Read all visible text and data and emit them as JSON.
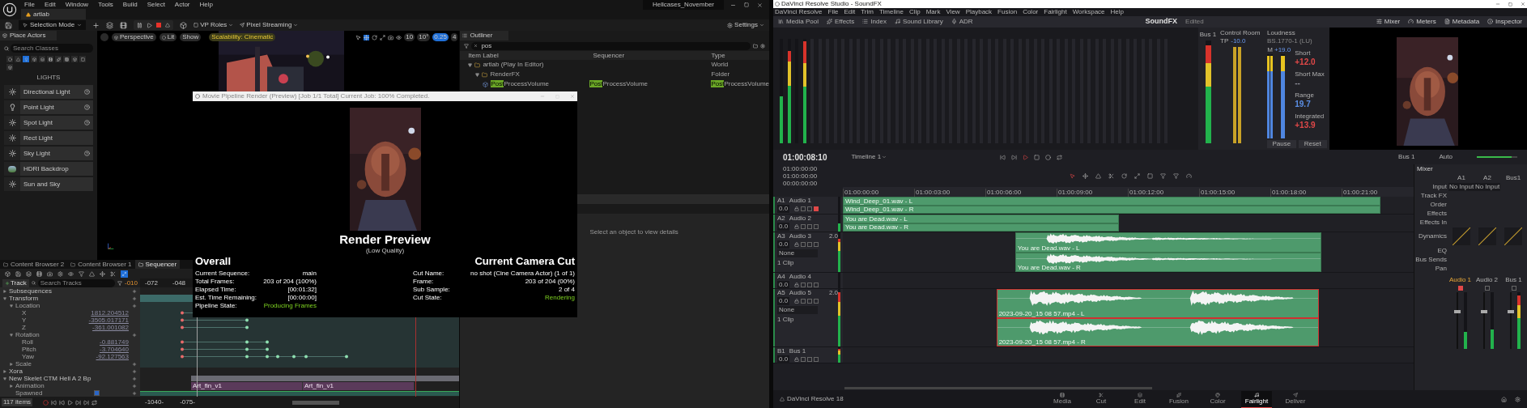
{
  "unreal": {
    "menu": [
      "File",
      "Edit",
      "Window",
      "Tools",
      "Build",
      "Select",
      "Actor",
      "Help"
    ],
    "document_tab": "artlab",
    "project": "Hellcases_November",
    "toolbar": {
      "mode": "Selection Mode",
      "vp_roles": "VP Roles",
      "pixel_streaming": "Pixel Streaming",
      "settings": "Settings"
    },
    "place_actors": {
      "title": "Place Actors",
      "search_placeholder": "Search Classes",
      "category": "LIGHTS",
      "category_tabs": [
        {
          "selected": false
        },
        {
          "selected": false
        },
        {
          "selected": true
        },
        {
          "selected": false
        },
        {
          "selected": false
        },
        {
          "selected": false
        },
        {
          "selected": false
        },
        {
          "selected": false
        },
        {
          "selected": false
        },
        {
          "selected": false
        },
        {
          "selected": false
        }
      ],
      "items": [
        {
          "label": "Directional Light",
          "help": true
        },
        {
          "label": "Point Light",
          "help": true
        },
        {
          "label": "Spot Light",
          "help": true
        },
        {
          "label": "Rect Light",
          "help": false
        },
        {
          "label": "Sky Light",
          "help": true
        },
        {
          "label": "HDRI Backdrop",
          "help": false
        },
        {
          "label": "Sun and Sky",
          "help": false
        }
      ]
    },
    "viewport": {
      "view": "Perspective",
      "lighting": "Lit",
      "show": "Show",
      "scalability": "Scalability: Cinematic",
      "grid": "10",
      "rotation": "10°",
      "scale": "0.25",
      "camera_speed": "4"
    },
    "outliner": {
      "title": "Outliner",
      "search": "pos",
      "columns": [
        "Item Label",
        "Sequencer",
        "Type"
      ],
      "rows": [
        {
          "label": "artlab (Play In Editor)",
          "type": "World",
          "expanded": true,
          "children": [
            {
              "label": "RenderFX",
              "type": "Folder",
              "expanded": true,
              "children": [
                {
                  "match": "Post",
                  "label": "ProcessVolume",
                  "sequencer_match": "Post",
                  "sequencer": "ProcessVolume",
                  "type_match": "Post",
                  "type": "ProcessVolume"
                }
              ]
            }
          ]
        }
      ]
    },
    "details": {
      "empty_text": "Select an object to view details"
    },
    "panel_tabs": [
      {
        "label": "Content Browser 2",
        "selected": false
      },
      {
        "label": "Content Browser 1",
        "selected": false
      },
      {
        "label": "Sequencer",
        "selected": true
      }
    ],
    "sequencer": {
      "add_track": "Track",
      "search_placeholder": "Search Tracks",
      "frame": "-010",
      "ruler": [
        "-072",
        "-048"
      ],
      "tracks": [
        {
          "label": "Subsequences",
          "expanded": false
        },
        {
          "label": "Transform",
          "expanded": true,
          "children": [
            {
              "label": "Location",
              "expanded": true,
              "children": [
                {
                  "label": "X",
                  "value": "1812.204512"
                },
                {
                  "label": "Y",
                  "value": "-3505.017171"
                },
                {
                  "label": "Z",
                  "value": "-361.001082"
                }
              ]
            },
            {
              "label": "Rotation",
              "expanded": true,
              "children": [
                {
                  "label": "Roll",
                  "value": "-0.881749"
                },
                {
                  "label": "Pitch",
                  "value": "-3.704640"
                },
                {
                  "label": "Yaw",
                  "value": "-92.127563"
                }
              ]
            },
            {
              "label": "Scale",
              "expanded": false
            }
          ]
        },
        {
          "label": "Xora",
          "expanded": false
        },
        {
          "label": "New Skelet CTM Hell A 2 Bp",
          "expanded": true,
          "children": [
            {
              "label": "Animation",
              "expanded": false
            },
            {
              "label": "Spawned",
              "checked": true
            }
          ]
        }
      ],
      "clips": [
        "Art_fin_v1",
        "Art_fin_v1"
      ],
      "item_count": "117 items",
      "range": [
        "-1040-",
        "-075-"
      ]
    },
    "render_window": {
      "title": "Movie Pipeline Render (Preview) [Job 1/1 Total] Current Job: 100% Completed.",
      "heading": "Render Preview",
      "subheading": "(Low Quality)",
      "overall": {
        "title": "Overall",
        "rows": [
          {
            "label": "Current Sequence:",
            "value": "main",
            "highlight": false
          },
          {
            "label": "Total Frames:",
            "value": "203 of 204 (100%)",
            "highlight": false
          },
          {
            "label": "Elapsed Time:",
            "value": "[00:01:32]",
            "highlight": false
          },
          {
            "label": "Est. Time Remaining:",
            "value": "[00:00:00]",
            "highlight": false
          },
          {
            "label": "Pipeline State:",
            "value": "Producing Frames",
            "highlight": true
          }
        ]
      },
      "camera_cut": {
        "title": "Current Camera Cut",
        "rows": [
          {
            "label": "Cut Name:",
            "value": "no shot (Cine Camera Actor) (1 of 1)",
            "highlight": false
          },
          {
            "label": "Frame:",
            "value": "203 of 204 (00%)",
            "highlight": false
          },
          {
            "label": "Sub Sample:",
            "value": "2 of 4",
            "highlight": false
          },
          {
            "label": "Cut State:",
            "value": "Rendering",
            "highlight": true
          }
        ]
      }
    }
  },
  "resolve": {
    "title": "DaVinci Resolve Studio - SoundFX",
    "menu": [
      "DaVinci Resolve",
      "File",
      "Edit",
      "Trim",
      "Timeline",
      "Clip",
      "Mark",
      "View",
      "Playback",
      "Fusion",
      "Color",
      "Fairlight",
      "Workspace",
      "Help"
    ],
    "toolbar_left": [
      "Media Pool",
      "Effects",
      "Index",
      "Sound Library",
      "ADR"
    ],
    "project": "SoundFX",
    "project_status": "Edited",
    "toolbar_right": [
      "Mixer",
      "Meters",
      "Metadata",
      "Inspector"
    ],
    "channel_meters": [
      {
        "level": 0.45
      },
      {
        "level": 0.88
      },
      {
        "level": 0
      },
      {
        "level": 0.98
      }
    ],
    "bus_meter": {
      "label": "Bus 1",
      "level": 0.95
    },
    "control_room": {
      "title": "Control Room",
      "tp_label": "TP",
      "tp_value": "-10.0",
      "meters": [
        {
          "level": 1
        },
        {
          "level": 1
        }
      ]
    },
    "loudness": {
      "title": "Loudness",
      "standard": "BS.1770-1 (LU)",
      "m_label": "M",
      "m_value": "+19.0",
      "meters": [
        {
          "level": 0.98
        },
        {
          "level": 0.98
        },
        {
          "level": 0.98
        }
      ],
      "readings": [
        {
          "label": "Short",
          "value": "+12.0",
          "color": "#e04848"
        },
        {
          "label": "Short Max",
          "value": "--",
          "color": "#8a8a95"
        },
        {
          "label": "Range",
          "value": "19.7",
          "color": "#5b8fe6"
        },
        {
          "label": "Integrated",
          "value": "+13.9",
          "color": "#e04848"
        }
      ],
      "buttons": [
        "Pause",
        "Reset"
      ]
    },
    "timecode": "01:00:08:10",
    "timeline_name": "Timeline 1",
    "monitor": "Bus 1",
    "mode": "Auto",
    "output_volume": {
      "level": 0.85
    },
    "header_timecodes": [
      "01:00:00:00",
      "01:00:00:00",
      "00:00:00:00"
    ],
    "ruler": [
      "01:00:00:00",
      "01:00:03:00",
      "01:00:06:00",
      "01:00:09:00",
      "01:00:12:00",
      "01:00:15:00",
      "01:00:18:00",
      "01:00:21:00"
    ],
    "tracks": [
      {
        "id": "A1",
        "name": "Audio 1",
        "volume": "0.0",
        "muted": true,
        "level": 0,
        "clips": [
          "Wind_Deep_01.wav - L",
          "Wind_Deep_01.wav - R"
        ],
        "selected": false,
        "waveform": false
      },
      {
        "id": "A2",
        "name": "Audio 2",
        "volume": "0.0",
        "muted": false,
        "level": 0.5,
        "clips": [
          "You are Dead.wav - L",
          "You are Dead.wav - R"
        ],
        "selected": false,
        "waveform": false
      },
      {
        "id": "A3",
        "name": "Audio 3",
        "volume": "0.0",
        "format": "2.0",
        "effect": "None",
        "clip_count": "1 Clip",
        "muted": false,
        "level": 0.85,
        "clips": [
          "You are Dead.wav - L",
          "You are Dead.wav - R"
        ],
        "selected": false,
        "waveform": true
      },
      {
        "id": "A4",
        "name": "Audio 4",
        "volume": "0.0",
        "muted": false,
        "level": 0
      },
      {
        "id": "A5",
        "name": "Audio 5",
        "volume": "0.0",
        "format": "2.0",
        "effect": "None",
        "clip_count": "1 Clip",
        "muted": false,
        "level": 0.95,
        "clips": [
          "2023-09-20_15 08 57.mp4 - L",
          "2023-09-20_15 08 57.mp4 - R"
        ],
        "selected": true,
        "waveform": true
      },
      {
        "id": "B1",
        "name": "Bus 1",
        "volume": "0.0",
        "muted": false,
        "level": 0.9
      }
    ],
    "mixer": {
      "title": "Mixer",
      "columns": [
        "A1",
        "A2",
        "Bus1"
      ],
      "row_labels": [
        "Input",
        "Track FX",
        "Order",
        "Effects",
        "Effects In",
        "Dynamics",
        "EQ",
        "Bus Sends",
        "Pan"
      ],
      "inputs": [
        "No Input",
        "No Input"
      ],
      "strips": [
        {
          "name": "Audio 1",
          "muted": true,
          "level": 0.3
        },
        {
          "name": "Audio 2",
          "muted": false,
          "level": 0.35
        },
        {
          "name": "Bus 1",
          "muted": false,
          "level": 0.95
        }
      ]
    },
    "brand": "DaVinci Resolve 18",
    "pages": [
      {
        "label": "Media",
        "selected": false
      },
      {
        "label": "Cut",
        "selected": false
      },
      {
        "label": "Edit",
        "selected": false
      },
      {
        "label": "Fusion",
        "selected": false
      },
      {
        "label": "Color",
        "selected": false
      },
      {
        "label": "Fairlight",
        "selected": true
      },
      {
        "label": "Deliver",
        "selected": false
      }
    ]
  }
}
